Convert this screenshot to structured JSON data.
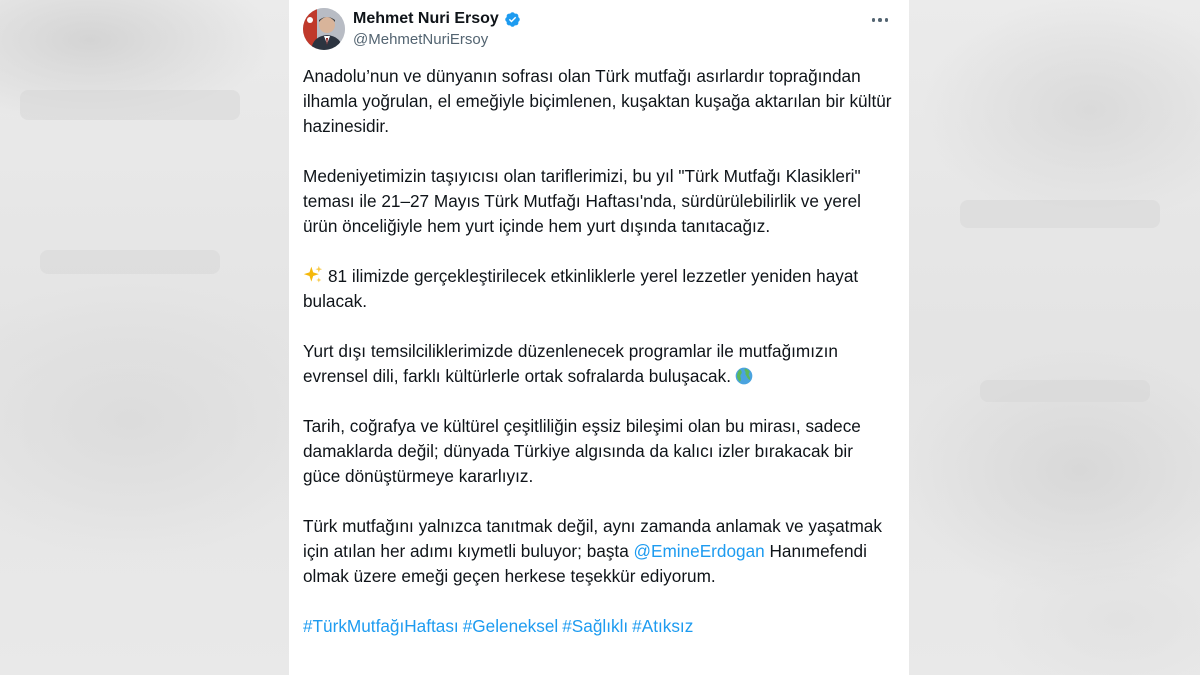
{
  "author": {
    "name": "Mehmet Nuri Ersoy",
    "handle": "@MehmetNuriErsoy",
    "verified": true
  },
  "tweet": {
    "paragraph_1": "Anadolu’nun ve dünyanın sofrası olan Türk mutfağı asırlardır toprağından ilhamla yoğrulan, el emeğiyle biçimlenen, kuşaktan kuşağa aktarılan bir kültür hazinesidir.",
    "paragraph_2": "Medeniyetimizin taşıyıcısı olan tariflerimizi, bu yıl \"Türk Mutfağı Klasikleri\" teması ile 21–27 Mayıs Türk Mutfağı Haftası'nda, sürdürülebilirlik ve yerel ürün önceliğiyle hem yurt içinde hem yurt dışında tanıtacağız.",
    "paragraph_3": "81 ilimizde gerçekleştirilecek etkinliklerle yerel lezzetler yeniden hayat bulacak.",
    "paragraph_4": "Yurt dışı temsilciliklerimizde düzenlenecek programlar ile mutfağımızın evrensel dili, farklı kültürlerle ortak sofralarda buluşacak.",
    "paragraph_5": "Tarih, coğrafya ve kültürel çeşitliliğin eşsiz bileşimi olan bu mirası, sadece damaklarda değil; dünyada Türkiye algısında da kalıcı izler bırakacak bir güce dönüştürmeye kararlıyız.",
    "paragraph_6_before_mention": "Türk mutfağını yalnızca tanıtmak değil, aynı zamanda anlamak ve yaşatmak için atılan her adımı kıymetli buluyor; başta ",
    "mention": "@EmineErdogan",
    "paragraph_6_after_mention": " Hanımefendi olmak üzere emeği geçen herkese teşekkür ediyorum.",
    "hashtags": [
      "#TürkMutfağıHaftası",
      "#Geleneksel",
      "#Sağlıklı",
      "#Atıksız"
    ]
  },
  "icons": {
    "paragraph_3_emoji": "sparkles-icon",
    "paragraph_4_emoji": "globe-icon",
    "more": "more-horizontal-icon",
    "verified": "verified-badge-icon"
  },
  "colors": {
    "text": "#0f1419",
    "secondary": "#536471",
    "link": "#1d9bf0",
    "verified": "#1d9bf0"
  }
}
